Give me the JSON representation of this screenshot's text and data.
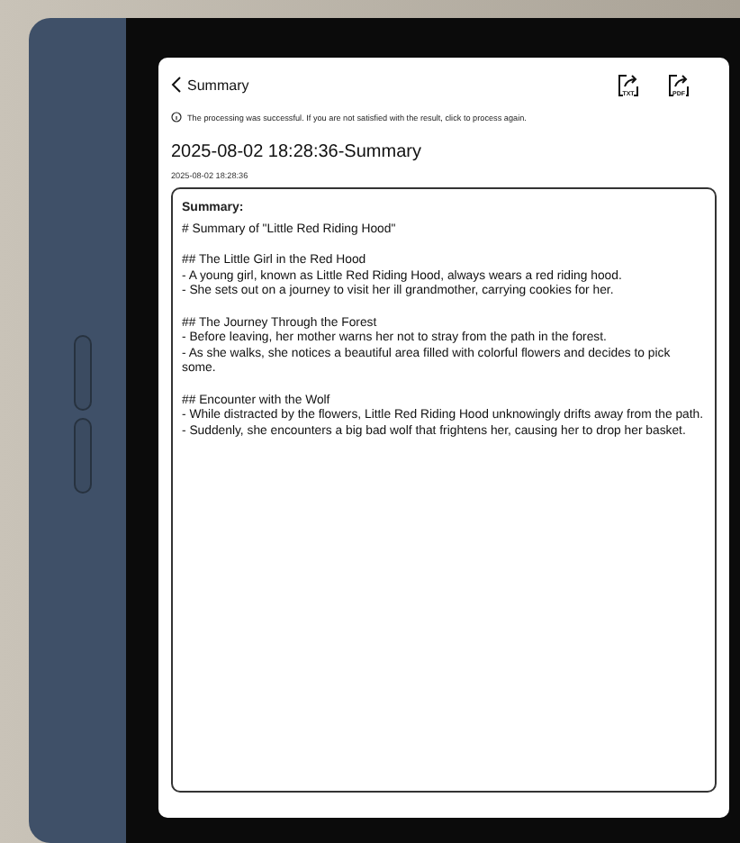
{
  "header": {
    "back_label": "Summary",
    "actions": [
      {
        "label": "TXT"
      },
      {
        "label": "PDF"
      }
    ]
  },
  "notice": "The processing was successful. If you are not satisfied with the result, click to process again.",
  "title": "2025-08-02 18:28:36-Summary",
  "date": "2025-08-02 18:28:36",
  "summary": {
    "label": "Summary:",
    "heading": "# Summary of \"Little Red Riding Hood\"",
    "sections": [
      {
        "heading": "## The Little Girl in the Red Hood",
        "bullets": [
          "- A young girl, known as Little Red Riding Hood, always wears a red riding hood.",
          "- She sets out on a journey to visit her ill grandmother, carrying cookies for her."
        ]
      },
      {
        "heading": "## The Journey Through the Forest",
        "bullets": [
          "- Before leaving, her mother warns her not to stray from the path in the forest.",
          "- As she walks, she notices a beautiful area filled with colorful flowers and decides to pick some."
        ]
      },
      {
        "heading": "## Encounter with the Wolf",
        "bullets": [
          "- While distracted by the flowers, Little Red Riding Hood unknowingly drifts away from the path.",
          "- Suddenly, she encounters a big bad wolf that frightens her, causing her to drop her basket."
        ]
      }
    ]
  }
}
